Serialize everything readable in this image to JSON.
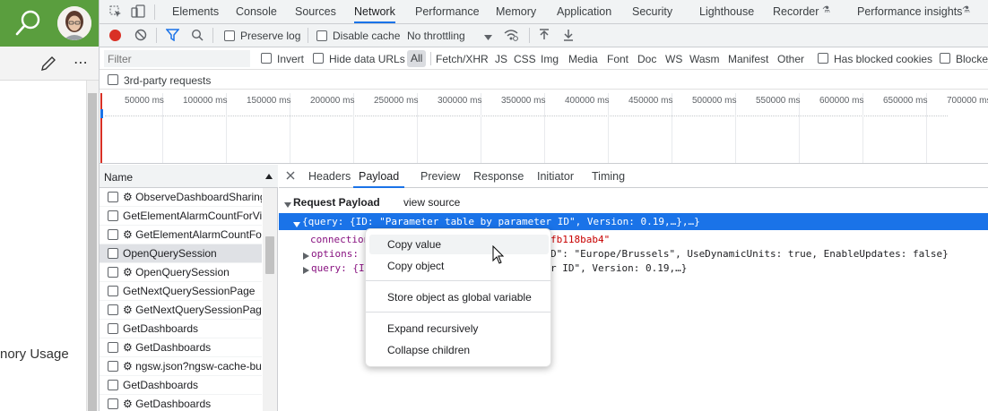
{
  "left_app": {
    "partial_label": "nory Usage"
  },
  "main_tabs": [
    "Elements",
    "Console",
    "Sources",
    "Network",
    "Performance",
    "Memory",
    "Application",
    "Security",
    "Lighthouse",
    "Recorder",
    "Performance insights"
  ],
  "network_toolbar": {
    "preserve_log": "Preserve log",
    "disable_cache": "Disable cache",
    "throttling": "No throttling"
  },
  "filter_bar": {
    "filter_placeholder": "Filter",
    "invert": "Invert",
    "hide_data_urls": "Hide data URLs",
    "types": [
      "All",
      "Fetch/XHR",
      "JS",
      "CSS",
      "Img",
      "Media",
      "Font",
      "Doc",
      "WS",
      "Wasm",
      "Manifest",
      "Other"
    ],
    "has_blocked_cookies": "Has blocked cookies",
    "blocked_partial": "Blocked",
    "third_party": "3rd-party requests"
  },
  "timeline_ticks": [
    "50000 ms",
    "100000 ms",
    "150000 ms",
    "200000 ms",
    "250000 ms",
    "300000 ms",
    "350000 ms",
    "400000 ms",
    "450000 ms",
    "500000 ms",
    "550000 ms",
    "600000 ms",
    "650000 ms",
    "700000 ms"
  ],
  "request_list": {
    "header": "Name",
    "rows": [
      "⚙ ObserveDashboardSharing",
      "GetElementAlarmCountForVie",
      "⚙ GetElementAlarmCountFor",
      "OpenQuerySession",
      "⚙ OpenQuerySession",
      "GetNextQuerySessionPage",
      "⚙ GetNextQuerySessionPage",
      "GetDashboards",
      "⚙ GetDashboards",
      "⚙ ngsw.json?ngsw-cache-bus",
      "GetDashboards",
      "⚙ GetDashboards"
    ]
  },
  "detail_tabs": [
    "Headers",
    "Payload",
    "Preview",
    "Response",
    "Initiator",
    "Timing"
  ],
  "payload": {
    "section_title": "Request Payload",
    "view_source": "view source",
    "root": "{query: {ID: \"Parameter table by parameter ID\", Version: 0.19,…},…}",
    "connection_key": "connection",
    "connection_tail": "fb118bab4\"",
    "options_key": "options:",
    "options_tail": "D\": \"Europe/Brussels\", UseDynamicUnits: true, EnableUpdates: false}",
    "query_key": "query: {I",
    "query_tail": "r ID\", Version: 0.19,…}"
  },
  "context_menu": {
    "items": [
      "Copy value",
      "Copy object",
      "Store object as global variable",
      "Expand recursively",
      "Collapse children"
    ]
  },
  "colors": {
    "app_green": "#5a9e3e",
    "accent_blue": "#1a73e8",
    "selection_blue": "#1a73e8",
    "record_red": "#d93025",
    "key_red": "#881280"
  }
}
